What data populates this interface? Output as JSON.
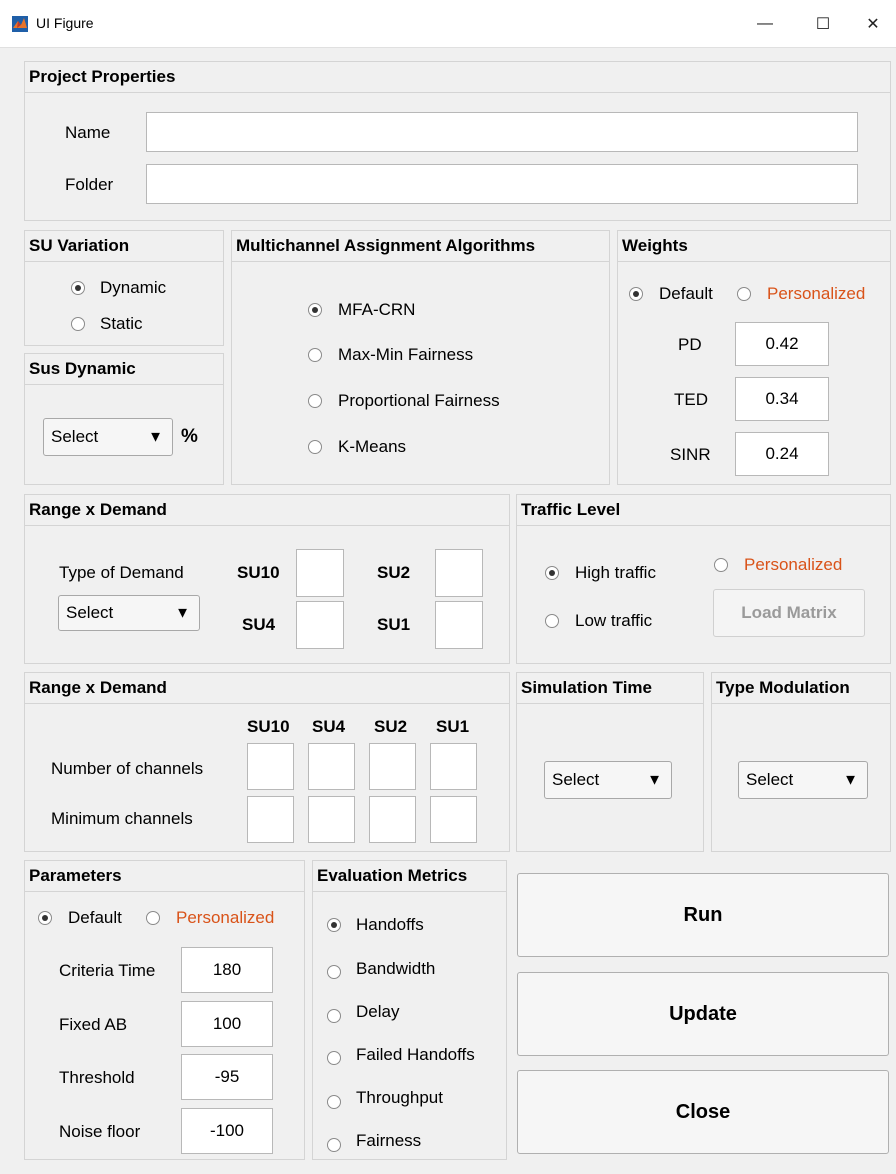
{
  "window": {
    "title": "UI Figure",
    "min_icon": "—",
    "max_icon": "☐",
    "close_icon": "✕"
  },
  "project": {
    "title": "Project Properties",
    "name_label": "Name",
    "folder_label": "Folder",
    "name_value": "",
    "folder_value": ""
  },
  "su_variation": {
    "title": "SU Variation",
    "options": [
      {
        "label": "Dynamic",
        "selected": true
      },
      {
        "label": "Static",
        "selected": false
      }
    ]
  },
  "sus_dynamic": {
    "title": "Sus Dynamic",
    "select": "Select",
    "unit": "%"
  },
  "algorithms": {
    "title": "Multichannel Assignment Algorithms",
    "options": [
      {
        "label": "MFA-CRN",
        "selected": true
      },
      {
        "label": "Max-Min Fairness",
        "selected": false
      },
      {
        "label": "Proportional Fairness",
        "selected": false
      },
      {
        "label": "K-Means",
        "selected": false
      }
    ]
  },
  "weights": {
    "title": "Weights",
    "default_label": "Default",
    "personalized_label": "Personalized",
    "rows": [
      {
        "label": "PD",
        "value": "0.42"
      },
      {
        "label": "TED",
        "value": "0.34"
      },
      {
        "label": "SINR",
        "value": "0.24"
      }
    ]
  },
  "range_demand_1": {
    "title": "Range x Demand",
    "type_label": "Type of Demand",
    "select": "Select",
    "su_labels": [
      "SU10",
      "SU2",
      "SU4",
      "SU1"
    ]
  },
  "traffic": {
    "title": "Traffic Level",
    "high": "High traffic",
    "low": "Low traffic",
    "personalized": "Personalized",
    "load_matrix": "Load Matrix"
  },
  "range_demand_2": {
    "title": "Range x Demand",
    "columns": [
      "SU10",
      "SU4",
      "SU2",
      "SU1"
    ],
    "rows": [
      "Number of channels",
      "Minimum channels"
    ]
  },
  "sim_time": {
    "title": "Simulation Time",
    "select": "Select"
  },
  "modulation": {
    "title": "Type Modulation",
    "select": "Select"
  },
  "parameters": {
    "title": "Parameters",
    "default_label": "Default",
    "personalized_label": "Personalized",
    "rows": [
      {
        "label": "Criteria Time",
        "value": "180"
      },
      {
        "label": "Fixed AB",
        "value": "100"
      },
      {
        "label": "Threshold",
        "value": "-95"
      },
      {
        "label": "Noise floor",
        "value": "-100"
      }
    ]
  },
  "metrics": {
    "title": "Evaluation Metrics",
    "options": [
      {
        "label": "Handoffs",
        "selected": true
      },
      {
        "label": "Bandwidth",
        "selected": false
      },
      {
        "label": "Delay",
        "selected": false
      },
      {
        "label": "Failed Handoffs",
        "selected": false
      },
      {
        "label": "Throughput",
        "selected": false
      },
      {
        "label": "Fairness",
        "selected": false
      }
    ]
  },
  "actions": {
    "run": "Run",
    "update": "Update",
    "close": "Close"
  },
  "colors": {
    "accent_orange": "#d95319"
  }
}
